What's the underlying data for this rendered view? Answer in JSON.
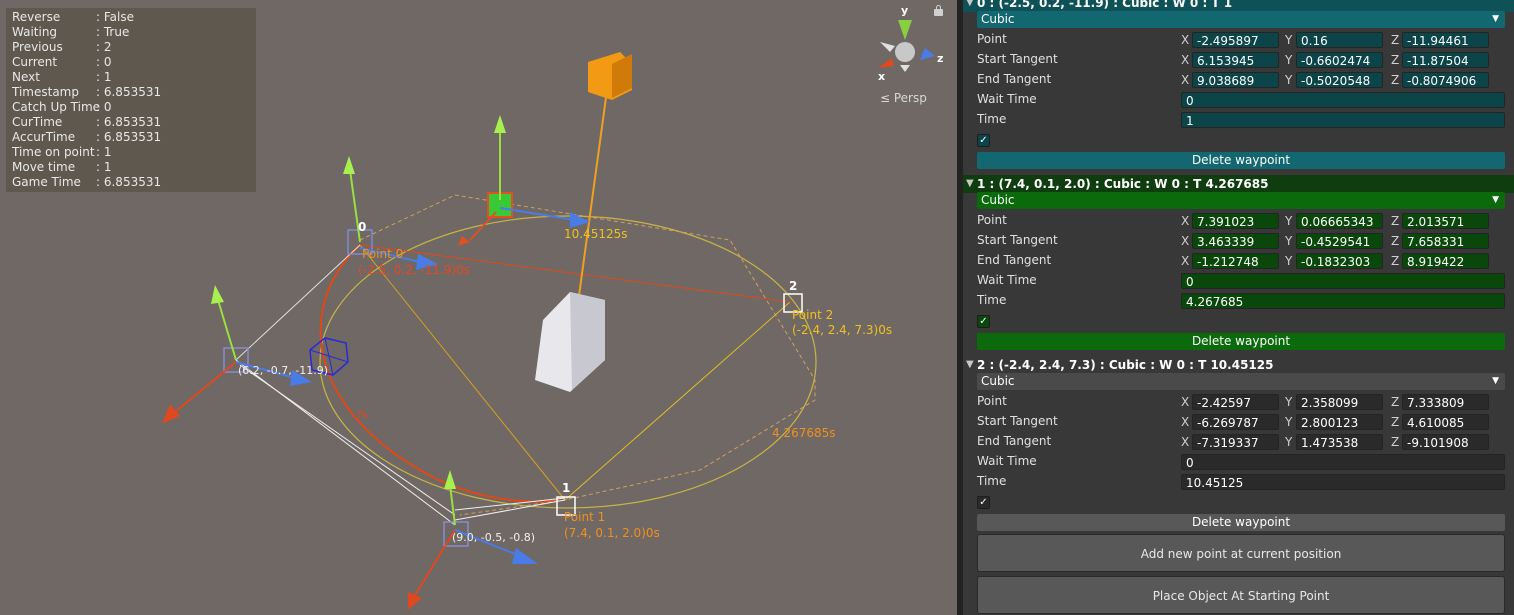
{
  "scene": {
    "debug": [
      {
        "key": "Reverse",
        "value": ": False"
      },
      {
        "key": "Waiting",
        "value": ": True"
      },
      {
        "key": "Previous",
        "value": ": 2"
      },
      {
        "key": "Current",
        "value": ": 0"
      },
      {
        "key": "Next",
        "value": ": 1"
      },
      {
        "key": "Timestamp",
        "value": ": 6.853531"
      },
      {
        "key": "Catch Up Time",
        "value": ": 0"
      },
      {
        "key": "CurTime",
        "value": ": 6.853531"
      },
      {
        "key": "AccurTime",
        "value": ": 6.853531"
      },
      {
        "key": "Time on point",
        "value": ": 1"
      },
      {
        "key": "Move time",
        "value": ": 1"
      },
      {
        "key": "Game Time",
        "value": ": 6.853531"
      }
    ],
    "persp_label": "≤ Persp",
    "gizmo_axes": {
      "x": "x",
      "y": "y",
      "z": "z"
    },
    "labels": {
      "idx0": "0",
      "idx1": "1",
      "idx2": "2",
      "p0_name": "Point 0",
      "p0_coords": "(-2.5, 0.2, -11.9)0s",
      "p1_name": "Point 1",
      "p1_coords": "(7.4, 0.1, 2.0)0s",
      "p2_name": "Point 2",
      "p2_coords": "(-2.4, 2.4, 7.3)0s",
      "t_a": "10.45125s",
      "t_b": "4.267685s",
      "tan_a": "(6.2, -0.7, -11.9)",
      "tan_b": "(9.0, -0.5, -0.8)",
      "small_mark": "fs"
    }
  },
  "inspector": {
    "waypoints": [
      {
        "header": "0 : (-2.5, 0.2, -11.9) : Cubic : W 0 : T 1",
        "mode": "Cubic",
        "point": {
          "x": "-2.495897",
          "y": "0.16",
          "z": "-11.94461"
        },
        "start_tangent": {
          "x": "6.153945",
          "y": "-0.6602474",
          "z": "-11.87504"
        },
        "end_tangent": {
          "x": "9.038689",
          "y": "-0.5020548",
          "z": "-0.8074906"
        },
        "wait_time": "0",
        "time": "1",
        "checked": true
      },
      {
        "header": "1 : (7.4, 0.1, 2.0) : Cubic : W 0 : T 4.267685",
        "mode": "Cubic",
        "point": {
          "x": "7.391023",
          "y": "0.06665343",
          "z": "2.013571"
        },
        "start_tangent": {
          "x": "3.463339",
          "y": "-0.4529541",
          "z": "7.658331"
        },
        "end_tangent": {
          "x": "-1.212748",
          "y": "-0.1832303",
          "z": "8.919422"
        },
        "wait_time": "0",
        "time": "4.267685",
        "checked": true
      },
      {
        "header": "2 : (-2.4, 2.4, 7.3) : Cubic : W 0 : T 10.45125",
        "mode": "Cubic",
        "point": {
          "x": "-2.42597",
          "y": "2.358099",
          "z": "7.333809"
        },
        "start_tangent": {
          "x": "-6.269787",
          "y": "2.800123",
          "z": "4.610085"
        },
        "end_tangent": {
          "x": "-7.319337",
          "y": "1.473538",
          "z": "-9.101908"
        },
        "wait_time": "0",
        "time": "10.45125",
        "checked": true
      }
    ],
    "labels": {
      "point": "Point",
      "start_tangent": "Start Tangent",
      "end_tangent": "End Tangent",
      "wait_time": "Wait Time",
      "time": "Time",
      "x": "X",
      "y": "Y",
      "z": "Z",
      "delete": "Delete waypoint",
      "check": "✓"
    },
    "add_point": "Add new point at current position",
    "place_object": "Place Object At Starting Point"
  }
}
